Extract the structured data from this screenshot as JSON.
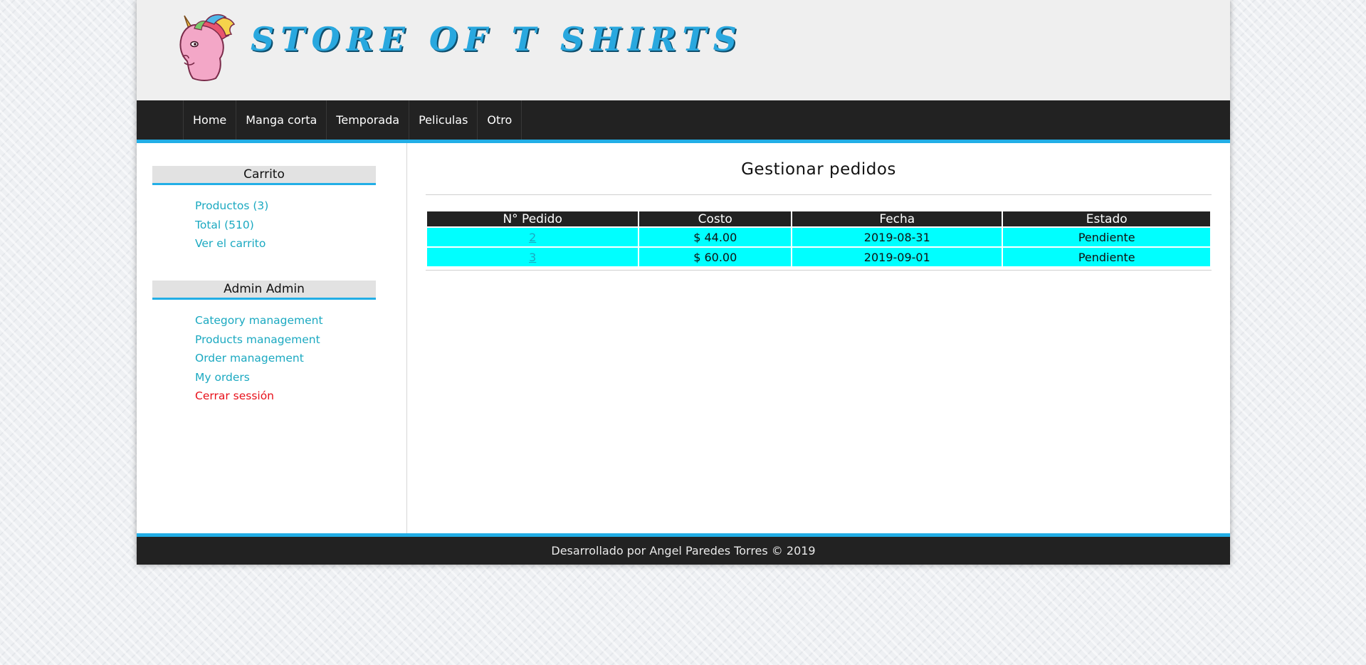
{
  "site": {
    "logo_text": "STORE OF T SHIRTS",
    "logo_icon": "unicorn-logo",
    "accent_color": "#22aee6"
  },
  "nav": {
    "items": [
      {
        "label": "Home"
      },
      {
        "label": "Manga corta"
      },
      {
        "label": "Temporada"
      },
      {
        "label": "Peliculas"
      },
      {
        "label": "Otro"
      }
    ]
  },
  "sidebar": {
    "cart": {
      "title": "Carrito",
      "links": [
        {
          "label": "Productos (3)"
        },
        {
          "label": "Total (510)"
        },
        {
          "label": "Ver el carrito"
        }
      ]
    },
    "user": {
      "title": "Admin Admin",
      "links": [
        {
          "label": "Category management"
        },
        {
          "label": "Products management"
        },
        {
          "label": "Order management"
        },
        {
          "label": "My orders"
        },
        {
          "label": "Cerrar sessión"
        }
      ]
    }
  },
  "main": {
    "title": "Gestionar pedidos",
    "table": {
      "headers": [
        "N° Pedido",
        "Costo",
        "Fecha",
        "Estado"
      ],
      "rows": [
        {
          "id": "2",
          "cost": "$ 44.00",
          "date": "2019-08-31",
          "status": "Pendiente"
        },
        {
          "id": "3",
          "cost": "$ 60.00",
          "date": "2019-09-01",
          "status": "Pendiente"
        }
      ]
    }
  },
  "footer": {
    "text": "Desarrollado por Angel Paredes Torres © 2019"
  }
}
